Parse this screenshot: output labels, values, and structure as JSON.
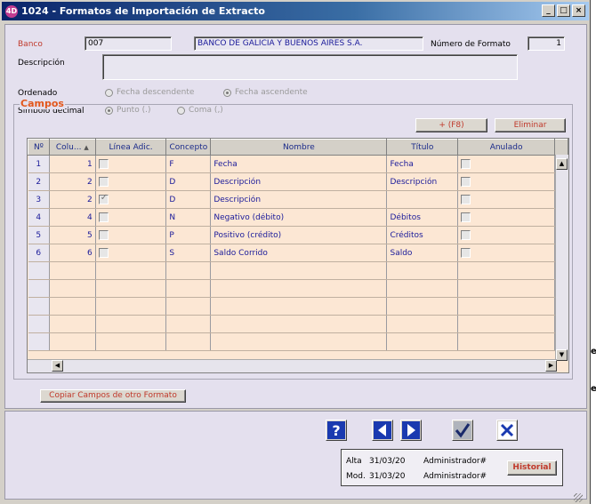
{
  "window": {
    "title": "1024 - Formatos de Importación de Extracto",
    "icon_text": "4D",
    "buttons": [
      "_",
      "□",
      "×"
    ]
  },
  "form": {
    "banco_label": "Banco",
    "banco_code": "007",
    "banco_name": "BANCO DE GALICIA Y BUENOS AIRES S.A.",
    "formato_label": "Número de Formato",
    "formato_value": "1",
    "descripcion_label": "Descripción",
    "descripcion_value": "",
    "ordenado_label": "Ordenado",
    "ordenado_options": [
      {
        "label": "Fecha descendente",
        "selected": false
      },
      {
        "label": "Fecha ascendente",
        "selected": true
      }
    ],
    "decimal_label": "Símbolo decimal",
    "decimal_options": [
      {
        "label": "Punto (.)",
        "selected": true
      },
      {
        "label": "Coma (,)",
        "selected": false
      }
    ]
  },
  "campos": {
    "title": "Campos",
    "add_label": "+ (F8)",
    "delete_label": "Eliminar",
    "columns": [
      "Nº",
      "Colu...",
      "Línea Adic.",
      "Concepto",
      "Nombre",
      "Título",
      "Anulado"
    ],
    "rows": [
      {
        "n": "1",
        "col": "1",
        "linea": false,
        "concepto": "F",
        "nombre": "Fecha",
        "titulo": "Fecha",
        "anulado": false
      },
      {
        "n": "2",
        "col": "2",
        "linea": false,
        "concepto": "D",
        "nombre": "Descripción",
        "titulo": "Descripción",
        "anulado": false
      },
      {
        "n": "3",
        "col": "2",
        "linea": true,
        "concepto": "D",
        "nombre": "Descripción",
        "titulo": "",
        "anulado": false
      },
      {
        "n": "4",
        "col": "4",
        "linea": false,
        "concepto": "N",
        "nombre": "Negativo (débito)",
        "titulo": "Débitos",
        "anulado": false
      },
      {
        "n": "5",
        "col": "5",
        "linea": false,
        "concepto": "P",
        "nombre": "Positivo (crédito)",
        "titulo": "Créditos",
        "anulado": false
      },
      {
        "n": "6",
        "col": "6",
        "linea": false,
        "concepto": "S",
        "nombre": "Saldo Corrido",
        "titulo": "Saldo",
        "anulado": false
      }
    ],
    "empty_rows": 5,
    "copy_label": "Copiar Campos de otro Formato"
  },
  "footer": {
    "alta_label": "Alta",
    "alta_date": "31/03/20",
    "alta_user": "Administrador#",
    "mod_label": "Mod.",
    "mod_date": "31/03/20",
    "mod_user": "Administrador#",
    "historial_label": "Historial",
    "help_glyph": "?"
  },
  "side_fragments": [
    "e",
    "e"
  ],
  "colors": {
    "accent": "#c0392b",
    "group_title": "#e2571c",
    "grid_row": "#fce7d4",
    "title_bar": "#0a246a"
  },
  "icons": [
    "help-icon",
    "arrow-left-icon",
    "arrow-right-icon",
    "check-icon",
    "close-icon"
  ]
}
